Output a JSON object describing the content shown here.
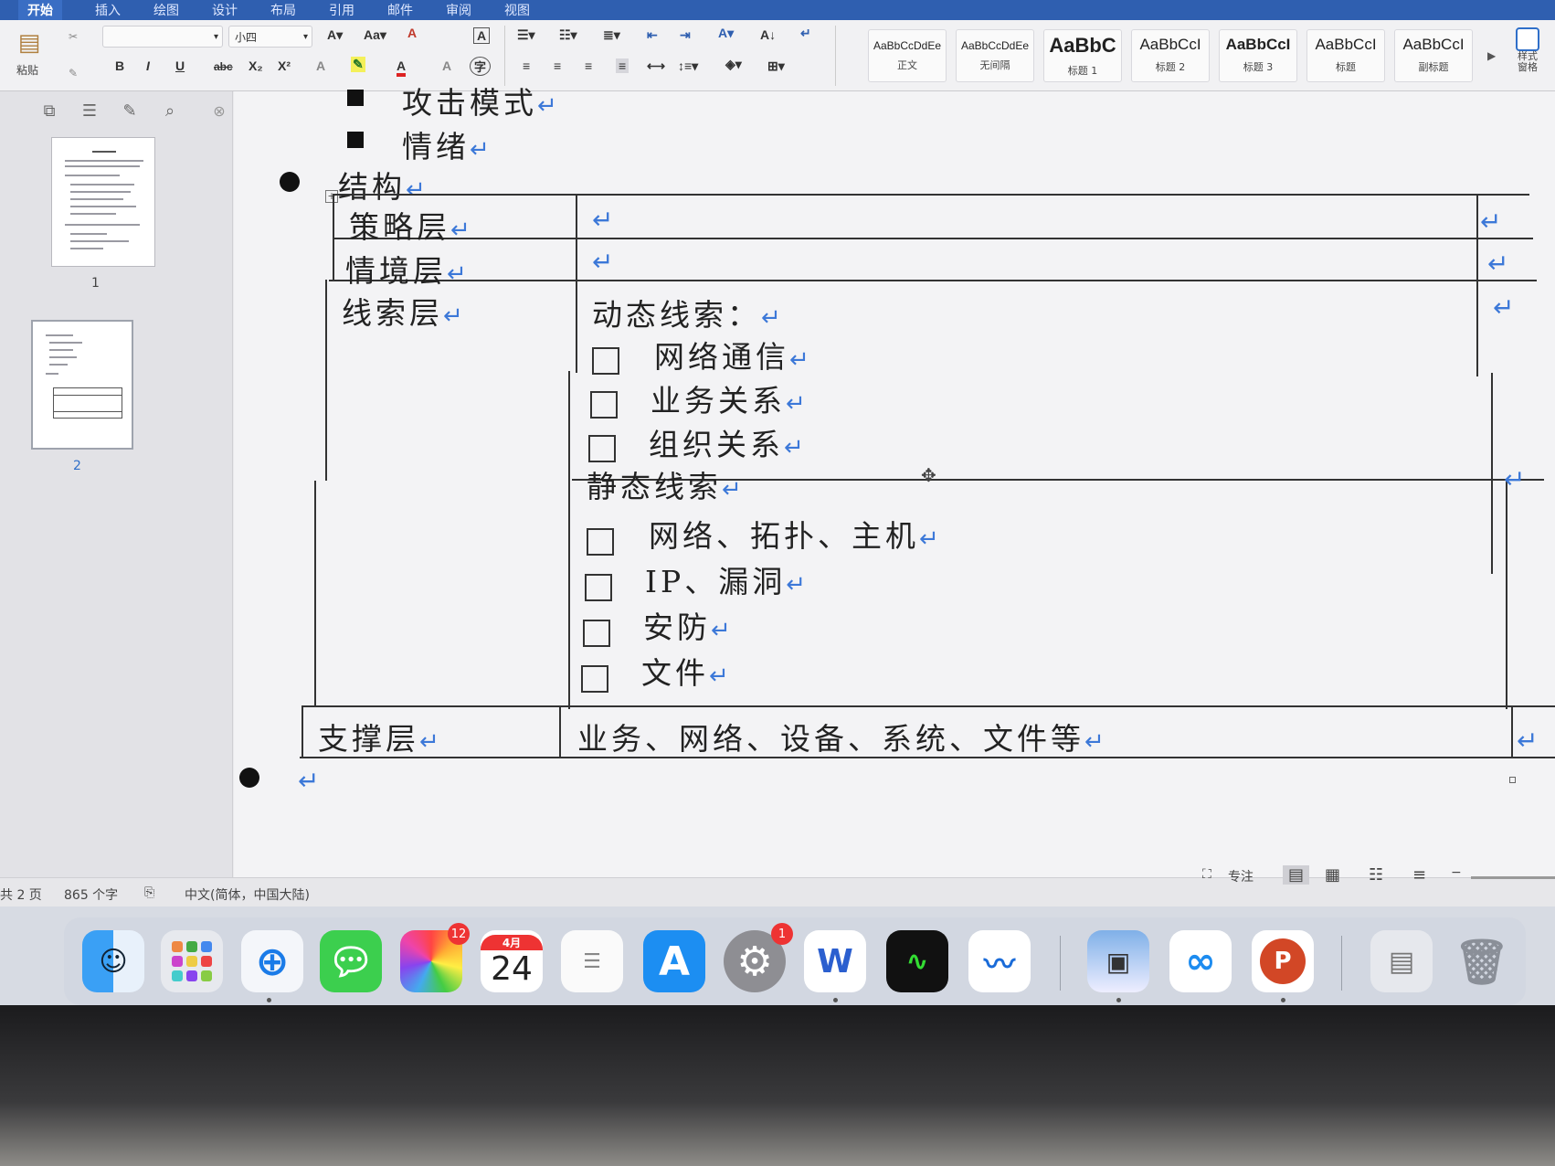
{
  "ribbon": {
    "tabs": [
      "开始",
      "插入",
      "绘图",
      "设计",
      "布局",
      "引用",
      "邮件",
      "审阅",
      "视图"
    ],
    "paste_label": "粘贴",
    "font_size": "小四",
    "font_name": "",
    "styles": [
      {
        "sample": "AaBbCcDdEe",
        "name": "正文"
      },
      {
        "sample": "AaBbCcDdEe",
        "name": "无间隔"
      },
      {
        "sample": "AaBbC",
        "name": "标题 1"
      },
      {
        "sample": "AaBbCcI",
        "name": "标题 2"
      },
      {
        "sample": "AaBbCcI",
        "name": "标题 3"
      },
      {
        "sample": "AaBbCcI",
        "name": "标题"
      },
      {
        "sample": "AaBbCcI",
        "name": "副标题"
      }
    ],
    "styles_pane_label": "样式\n窗格"
  },
  "nav": {
    "pages": [
      "1",
      "2"
    ]
  },
  "document": {
    "list_items": [
      "攻击模式",
      "情绪"
    ],
    "section_heading": "结构",
    "return_mark": "↵",
    "table": {
      "rows": [
        {
          "label": "策略层",
          "content": ""
        },
        {
          "label": "情境层",
          "content": ""
        },
        {
          "label": "线索层"
        },
        {
          "label": "支撑层",
          "content": "业务、网络、设备、系统、文件等"
        }
      ],
      "dynamic_title": "动态线索：",
      "dynamic_items": [
        "网络通信",
        "业务关系",
        "组织关系"
      ],
      "static_title": "静态线索",
      "static_items": [
        "网络、拓扑、主机",
        "IP、漏洞",
        "安防",
        "文件"
      ]
    }
  },
  "status": {
    "pages": "共 2 页",
    "words": "865 个字",
    "language": "中文(简体，中国大陆)",
    "focus": "专注"
  },
  "dock": {
    "photos_badge": "12",
    "calendar_month": "4月",
    "calendar_day": "24",
    "settings_badge": "1",
    "word_letter": "W",
    "ppt_letter": "P"
  }
}
